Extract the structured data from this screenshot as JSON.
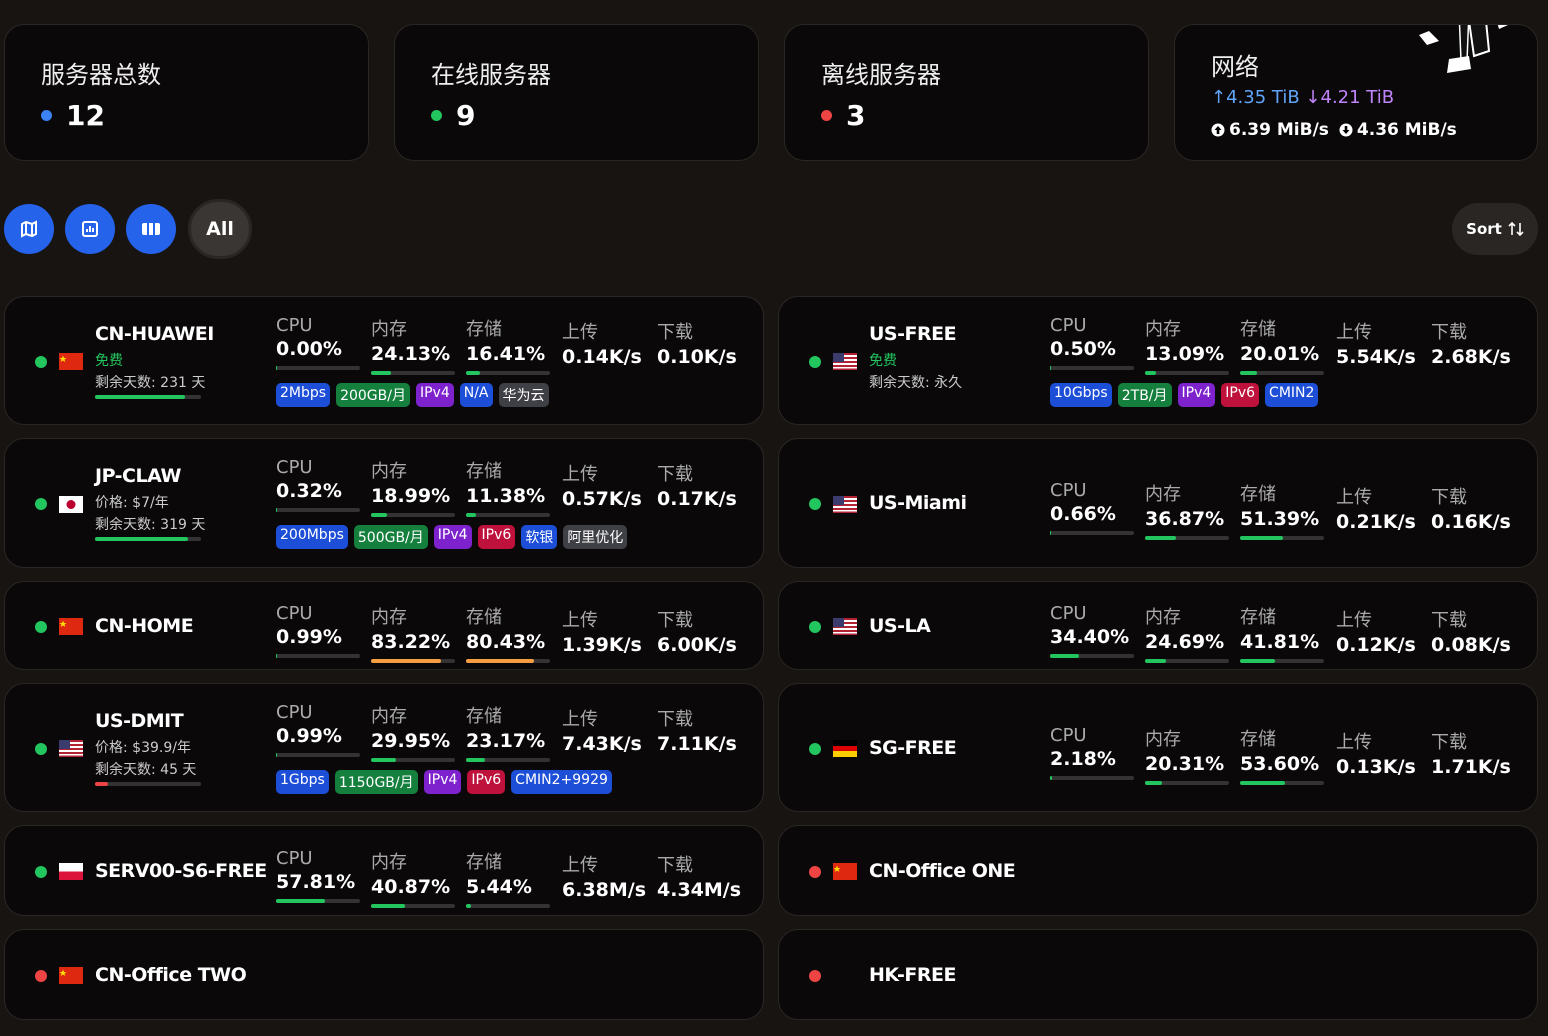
{
  "colors": {
    "green": "#22c55e",
    "red": "#ef4444",
    "blue": "#3b82f6",
    "orange": "#f59e42",
    "accent": "#2563eb"
  },
  "stats": [
    {
      "title": "服务器总数",
      "value": "12",
      "dot": "#3b82f6"
    },
    {
      "title": "在线服务器",
      "value": "9",
      "dot": "#22c55e"
    },
    {
      "title": "离线服务器",
      "value": "3",
      "dot": "#ef4444"
    }
  ],
  "network": {
    "title": "网络",
    "upload_total": "↑4.35 TiB",
    "download_total": "↓4.21 TiB",
    "upload_speed": "6.39 MiB/s",
    "download_speed": "4.36 MiB/s"
  },
  "filters": {
    "all_label": "All",
    "sort_label": "Sort",
    "icons": [
      "map-icon",
      "chart-icon",
      "columns-icon"
    ]
  },
  "metric_labels": {
    "cpu": "CPU",
    "mem": "内存",
    "disk": "存储",
    "up": "上传",
    "down": "下载"
  },
  "servers": [
    {
      "name": "CN-HUAWEI",
      "flag": "cn",
      "online": true,
      "price": "免费",
      "price_green": true,
      "days": "剩余天数: 231 天",
      "life": 0.85,
      "cpu": "0.00%",
      "cpu_p": 0.0,
      "mem": "24.13%",
      "mem_p": 0.2413,
      "disk": "16.41%",
      "disk_p": 0.1641,
      "up": "0.14K/s",
      "down": "0.10K/s",
      "tags": [
        {
          "t": "2Mbps",
          "c": "blue"
        },
        {
          "t": "200GB/月",
          "c": "green"
        },
        {
          "t": "IPv4",
          "c": "purple"
        },
        {
          "t": "N/A",
          "c": "blue"
        },
        {
          "t": "华为云",
          "c": "gray"
        }
      ]
    },
    {
      "name": "US-FREE",
      "flag": "us",
      "online": true,
      "price": "免费",
      "price_green": true,
      "days": "剩余天数: 永久",
      "cpu": "0.50%",
      "cpu_p": 0.005,
      "mem": "13.09%",
      "mem_p": 0.1309,
      "disk": "20.01%",
      "disk_p": 0.2001,
      "up": "5.54K/s",
      "down": "2.68K/s",
      "tags": [
        {
          "t": "10Gbps",
          "c": "blue"
        },
        {
          "t": "2TB/月",
          "c": "green"
        },
        {
          "t": "IPv4",
          "c": "purple"
        },
        {
          "t": "IPv6",
          "c": "pink"
        },
        {
          "t": "CMIN2",
          "c": "blue"
        }
      ]
    },
    {
      "name": "JP-CLAW",
      "flag": "jp",
      "online": true,
      "price": "价格: $7/年",
      "days": "剩余天数: 319 天",
      "life": 0.88,
      "cpu": "0.32%",
      "cpu_p": 0.0032,
      "mem": "18.99%",
      "mem_p": 0.1899,
      "disk": "11.38%",
      "disk_p": 0.1138,
      "up": "0.57K/s",
      "down": "0.17K/s",
      "tags": [
        {
          "t": "200Mbps",
          "c": "blue"
        },
        {
          "t": "500GB/月",
          "c": "green"
        },
        {
          "t": "IPv4",
          "c": "purple"
        },
        {
          "t": "IPv6",
          "c": "pink"
        },
        {
          "t": "软银",
          "c": "blue"
        },
        {
          "t": "阿里优化",
          "c": "gray"
        }
      ]
    },
    {
      "name": "US-Miami",
      "flag": "us",
      "online": true,
      "cpu": "0.66%",
      "cpu_p": 0.0066,
      "mem": "36.87%",
      "mem_p": 0.3687,
      "disk": "51.39%",
      "disk_p": 0.5139,
      "up": "0.21K/s",
      "down": "0.16K/s"
    },
    {
      "name": "CN-HOME",
      "flag": "cn",
      "online": true,
      "cpu": "0.99%",
      "cpu_p": 0.0099,
      "mem": "83.22%",
      "mem_p": 0.8322,
      "disk": "80.43%",
      "disk_p": 0.8043,
      "up": "1.39K/s",
      "down": "6.00K/s"
    },
    {
      "name": "US-LA",
      "flag": "us",
      "online": true,
      "cpu": "34.40%",
      "cpu_p": 0.344,
      "mem": "24.69%",
      "mem_p": 0.2469,
      "disk": "41.81%",
      "disk_p": 0.4181,
      "up": "0.12K/s",
      "down": "0.08K/s"
    },
    {
      "name": "US-DMIT",
      "flag": "us",
      "online": true,
      "price": "价格: $39.9/年",
      "days": "剩余天数: 45 天",
      "life": 0.12,
      "life_red": true,
      "cpu": "0.99%",
      "cpu_p": 0.0099,
      "mem": "29.95%",
      "mem_p": 0.2995,
      "disk": "23.17%",
      "disk_p": 0.2317,
      "up": "7.43K/s",
      "down": "7.11K/s",
      "tags": [
        {
          "t": "1Gbps",
          "c": "blue"
        },
        {
          "t": "1150GB/月",
          "c": "green"
        },
        {
          "t": "IPv4",
          "c": "purple"
        },
        {
          "t": "IPv6",
          "c": "pink"
        },
        {
          "t": "CMIN2+9929",
          "c": "blue"
        }
      ]
    },
    {
      "name": "SG-FREE",
      "flag": "de",
      "online": true,
      "cpu": "2.18%",
      "cpu_p": 0.0218,
      "mem": "20.31%",
      "mem_p": 0.2031,
      "disk": "53.60%",
      "disk_p": 0.536,
      "up": "0.13K/s",
      "down": "1.71K/s"
    },
    {
      "name": "SERV00-S6-FREE",
      "flag": "pl",
      "online": true,
      "cpu": "57.81%",
      "cpu_p": 0.5781,
      "mem": "40.87%",
      "mem_p": 0.4087,
      "disk": "5.44%",
      "disk_p": 0.0544,
      "up": "6.38M/s",
      "down": "4.34M/s"
    },
    {
      "name": "CN-Office ONE",
      "flag": "cn",
      "online": false
    },
    {
      "name": "CN-Office TWO",
      "flag": "cn",
      "online": false
    },
    {
      "name": "HK-FREE",
      "flag": "none",
      "online": false
    }
  ]
}
